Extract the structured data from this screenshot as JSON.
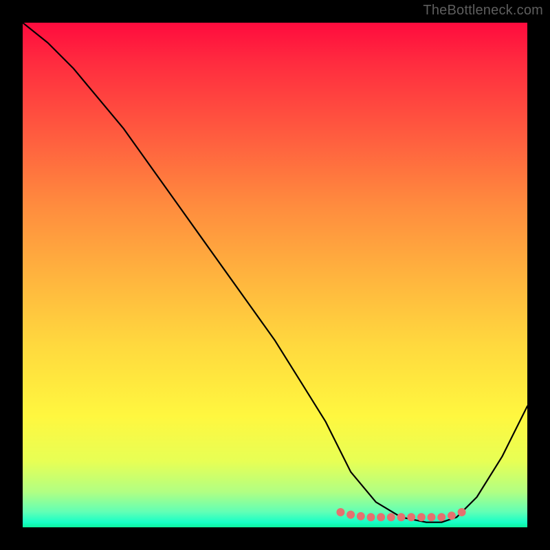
{
  "watermark": "TheBottleneck.com",
  "chart_data": {
    "type": "line",
    "title": "",
    "xlabel": "",
    "ylabel": "",
    "xlim": [
      0,
      100
    ],
    "ylim": [
      0,
      100
    ],
    "series": [
      {
        "name": "bottleneck-curve",
        "x": [
          0,
          5,
          10,
          15,
          20,
          25,
          30,
          35,
          40,
          45,
          50,
          55,
          60,
          63,
          65,
          70,
          75,
          80,
          83,
          86,
          90,
          95,
          100
        ],
        "values": [
          100,
          96,
          91,
          85,
          79,
          72,
          65,
          58,
          51,
          44,
          37,
          29,
          21,
          15,
          11,
          5,
          2,
          1,
          1,
          2,
          6,
          14,
          24
        ]
      },
      {
        "name": "optimal-zone-markers",
        "x": [
          63,
          65,
          67,
          69,
          71,
          73,
          75,
          77,
          79,
          81,
          83,
          85,
          87
        ],
        "values": [
          3.0,
          2.5,
          2.2,
          2.0,
          2.0,
          2.0,
          2.0,
          2.0,
          2.0,
          2.0,
          2.0,
          2.3,
          3.0
        ]
      }
    ],
    "colors": {
      "curve": "#000000",
      "markers": "#e5716f",
      "gradient_top": "#ff0b3e",
      "gradient_mid": "#fff73f",
      "gradient_bottom": "#0cf39f"
    }
  }
}
